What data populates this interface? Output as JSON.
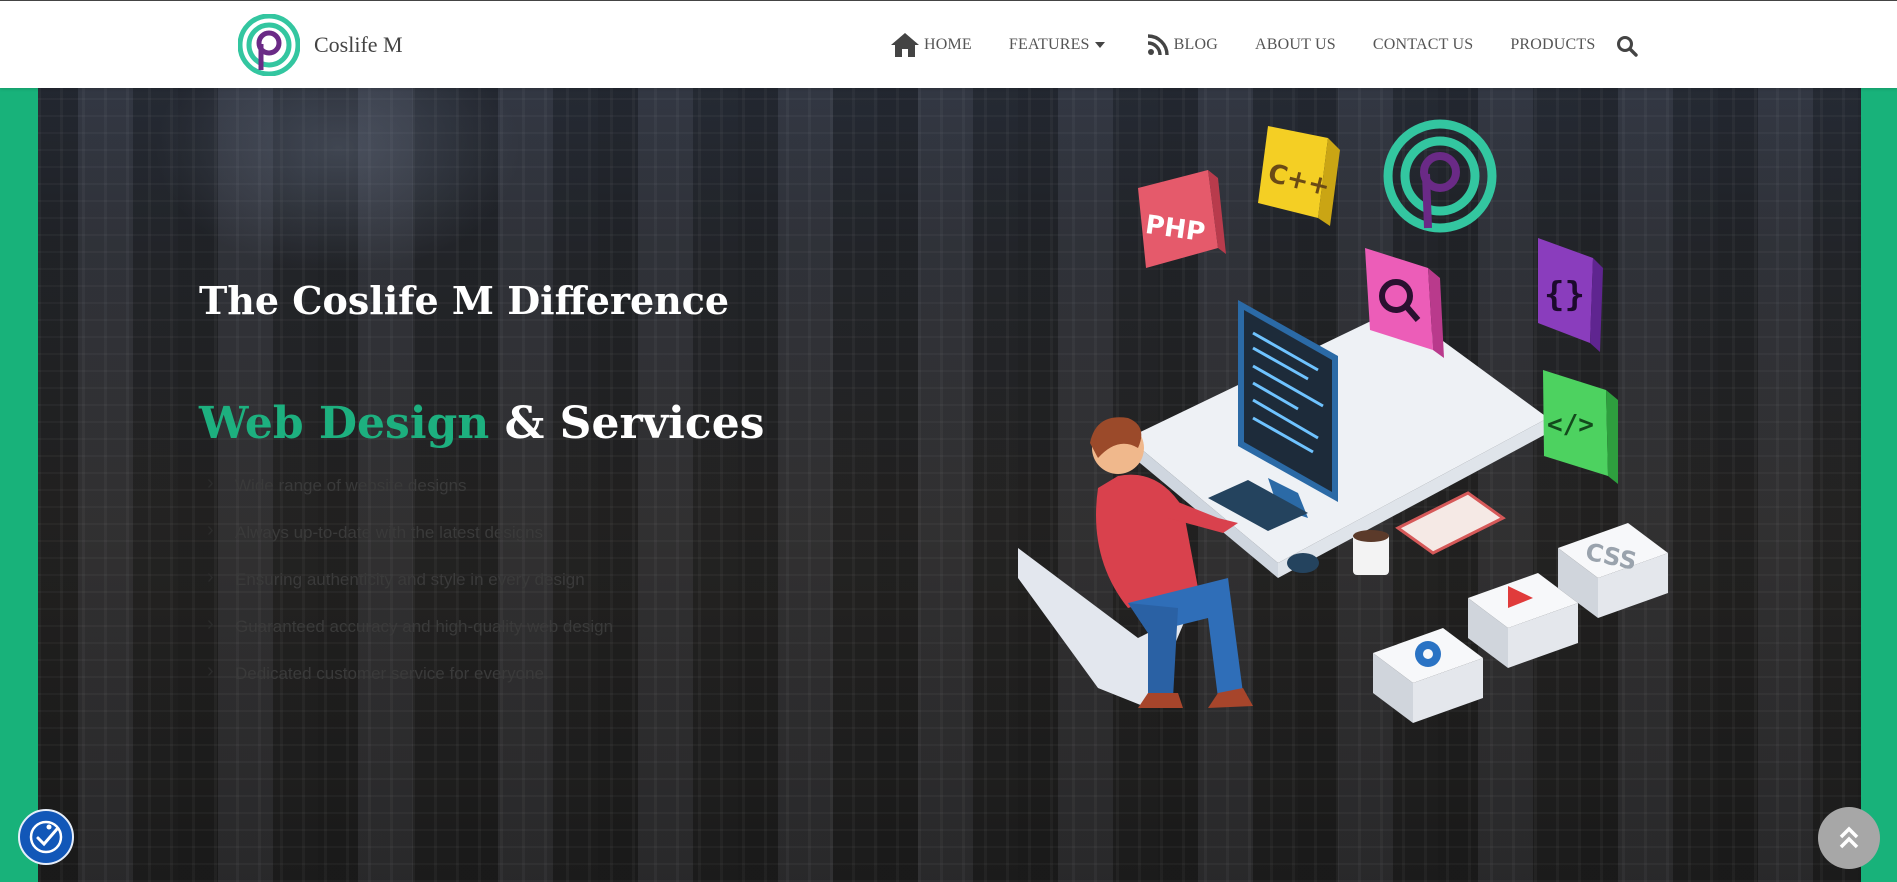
{
  "brand": {
    "name": "Coslife M",
    "logo_icon": "coslife-logo-icon"
  },
  "nav": {
    "home": "HOME",
    "features": "FEATURES",
    "blog": "BLOG",
    "about": "ABOUT US",
    "contact": "CONTACT US",
    "products": "PRODUCTS",
    "search_icon": "search-icon"
  },
  "hero": {
    "title": "The Coslife M Difference",
    "subtitle_accent": "Web Design",
    "subtitle_rest": "& Services",
    "bullets": [
      "Wide range of website designs",
      "Always up-to-date with the latest designs",
      "Ensuring authenticity and style in every design",
      "Guaranteed accuracy and high-quality web design",
      "Dedicated customer service for everyone."
    ],
    "illustration_labels": {
      "php": "PHP",
      "cpp": "C++",
      "css": "CSS"
    }
  },
  "colors": {
    "accent": "#1db07f",
    "side_band": "#18b27a",
    "accessibility": "#1257b8",
    "back_to_top": "#a7a7a7"
  },
  "floating": {
    "accessibility_icon": "accessibility-icon",
    "back_to_top_icon": "chevron-double-up-icon"
  }
}
